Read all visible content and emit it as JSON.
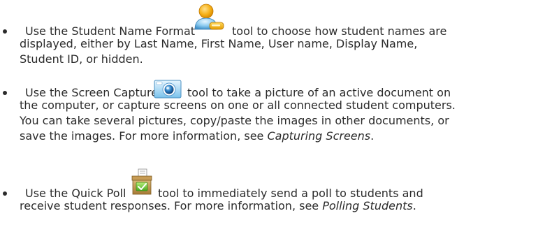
{
  "items": [
    {
      "icon": "student-name-format-icon",
      "line1_before": "Use the Student Name Format",
      "line1_after": "tool to choose how student names are",
      "line2": "displayed, either by Last Name, First Name, User name, Display Name,",
      "line3": "Student ID, or hidden."
    },
    {
      "icon": "camera-icon",
      "line1_before": "Use the Screen Capture",
      "line1_after": "tool to take a picture of an active document on",
      "line2": "the computer, or capture screens on one or all connected student computers.",
      "line3": "You can take several pictures, copy/paste the images in other documents, or",
      "line4_before": "save the images. For more information, see ",
      "line4_link": "Capturing Screens",
      "line4_after": "."
    },
    {
      "icon": "quick-poll-icon",
      "line1_before": "Use the Quick Poll",
      "line1_after": "tool to immediately send a poll to students and",
      "line2_before": "receive student responses. For more information, see ",
      "line2_link": "Polling Students",
      "line2_after": "."
    }
  ]
}
